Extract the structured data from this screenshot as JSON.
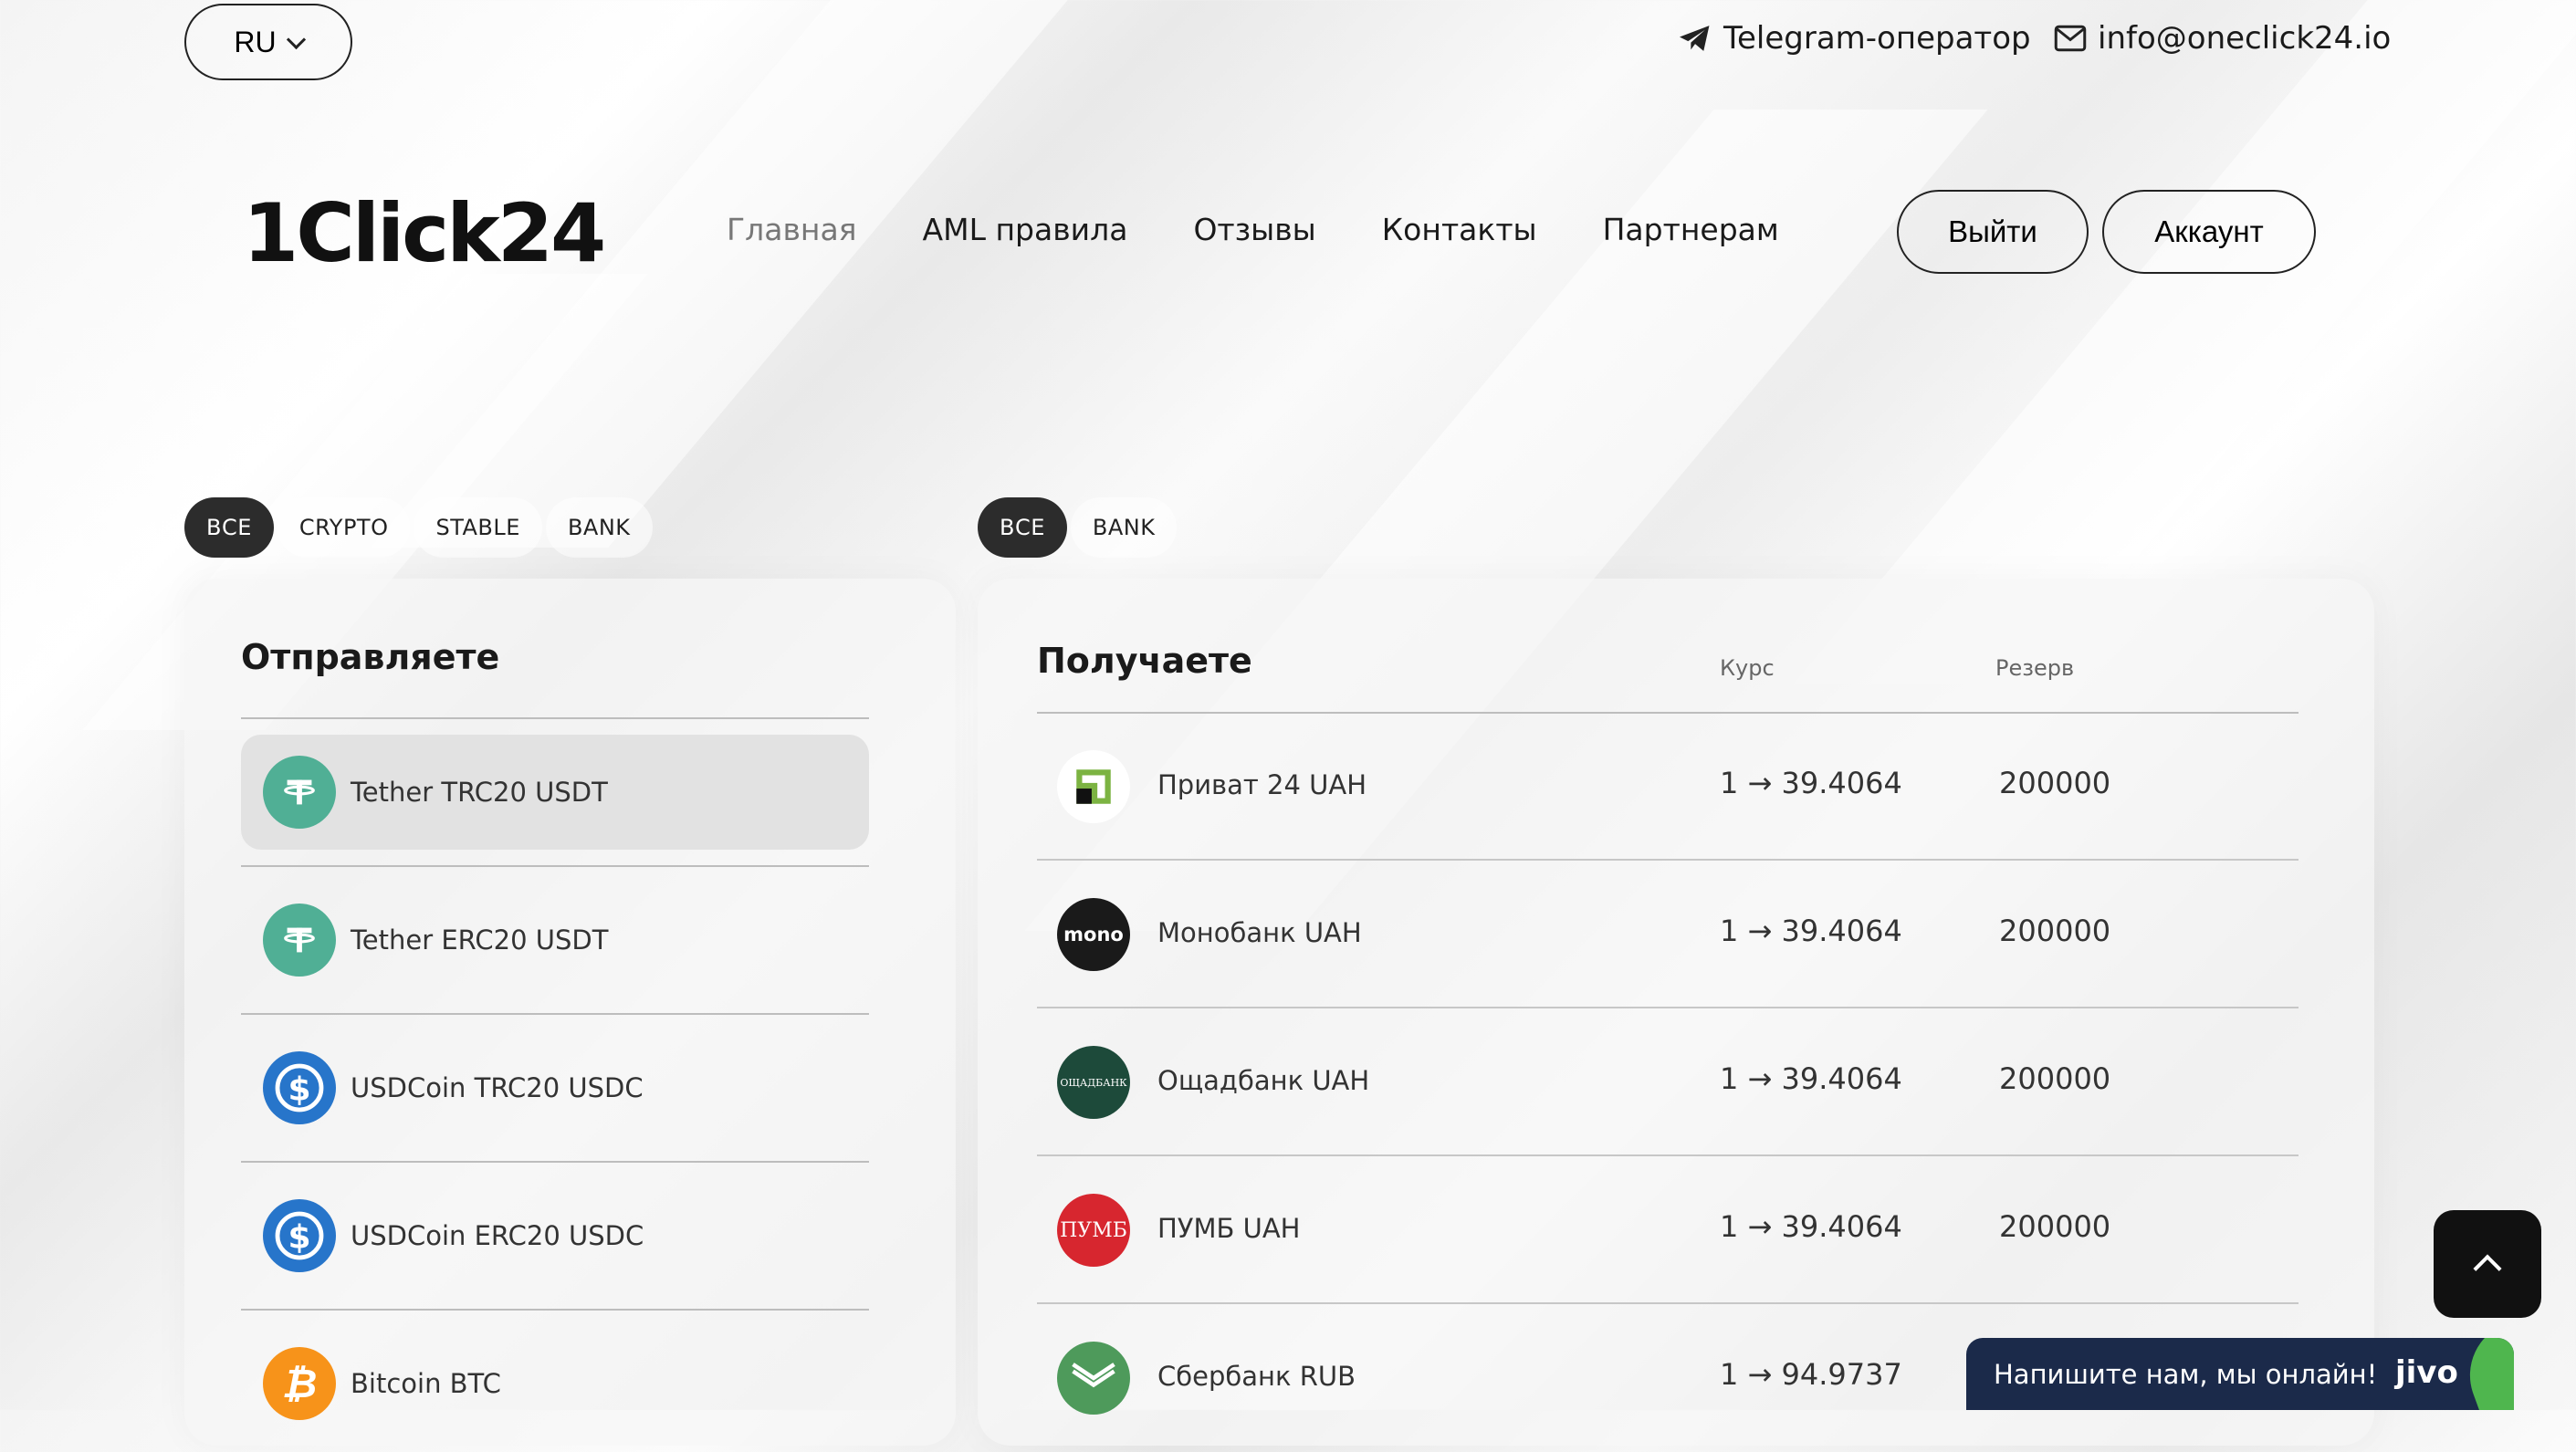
{
  "topbar": {
    "lang": "RU",
    "telegram": "Telegram-оператор",
    "email": "info@oneclick24.io"
  },
  "header": {
    "logo": "1Click24",
    "nav": [
      "Главная",
      "AML правила",
      "Отзывы",
      "Контакты",
      "Партнерам"
    ],
    "logout": "Выйти",
    "account": "Аккаунт"
  },
  "send_filters": [
    "ВСЕ",
    "CRYPTO",
    "STABLE",
    "BANK"
  ],
  "receive_filters": [
    "ВСЕ",
    "BANK"
  ],
  "send": {
    "title": "Отправляете",
    "items": [
      {
        "label": "Tether TRC20 USDT",
        "icon": "tether-icon"
      },
      {
        "label": "Tether ERC20 USDT",
        "icon": "tether-icon"
      },
      {
        "label": "USDCoin TRC20 USDC",
        "icon": "usdc-icon"
      },
      {
        "label": "USDCoin ERC20 USDC",
        "icon": "usdc-icon"
      },
      {
        "label": "Bitcoin BTC",
        "icon": "bitcoin-icon"
      }
    ]
  },
  "receive": {
    "title": "Получаете",
    "col_rate": "Курс",
    "col_reserve": "Резерв",
    "items": [
      {
        "name": "Приват 24 UAH",
        "rate": "1 → 39.4064",
        "reserve": "200000"
      },
      {
        "name": "Монобанк UAH",
        "rate": "1 → 39.4064",
        "reserve": "200000",
        "icon_text": "mono"
      },
      {
        "name": "Ощадбанк UAH",
        "rate": "1 → 39.4064",
        "reserve": "200000",
        "icon_text": "ОЩАДБАНК"
      },
      {
        "name": "ПУМБ UAH",
        "rate": "1 → 39.4064",
        "reserve": "200000",
        "icon_text": "ПУМБ"
      },
      {
        "name": "Сбербанк RUB",
        "rate": "1 → 94.9737",
        "reserve": ""
      }
    ]
  },
  "chat": {
    "text": "Напишите нам, мы онлайн!",
    "brand": "jivo"
  },
  "colors": {
    "tether": "#50AF95",
    "usdc": "#2775CA",
    "bitcoin": "#F7931A",
    "mono": "#1a1a1a",
    "oschad": "#1d4a3a",
    "pumb": "#d7262f",
    "sber": "#4e9a5b"
  }
}
